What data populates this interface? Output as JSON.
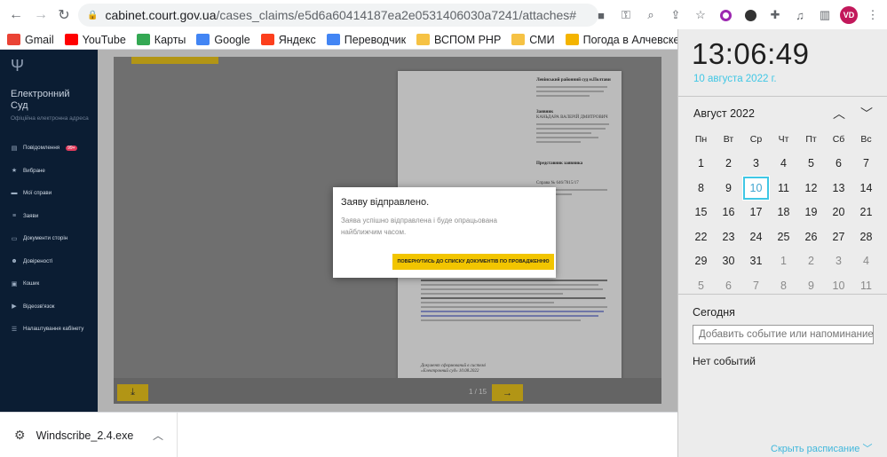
{
  "browser": {
    "url_host": "cabinet.court.gov.ua",
    "url_path": "/cases_claims/e5d6a60414187ea2e0531406030a7241/attaches#",
    "avatar": "VD",
    "bookmarks": [
      {
        "label": "Gmail",
        "icon": "gmail-icon",
        "color": "#ea4335"
      },
      {
        "label": "YouTube",
        "icon": "youtube-icon",
        "color": "#ff0000"
      },
      {
        "label": "Карты",
        "icon": "maps-icon",
        "color": "#34a853"
      },
      {
        "label": "Google",
        "icon": "google-icon",
        "color": "#4285f4"
      },
      {
        "label": "Яндекс",
        "icon": "yandex-icon",
        "color": "#fc3f1d"
      },
      {
        "label": "Переводчик",
        "icon": "translate-icon",
        "color": "#4285f4"
      },
      {
        "label": "ВСПОМ РНР",
        "icon": "folder-icon",
        "color": "#f6c244"
      },
      {
        "label": "СМИ",
        "icon": "folder-icon",
        "color": "#f6c244"
      },
      {
        "label": "Погода в Алчевске",
        "icon": "sun-icon",
        "color": "#f4b400"
      }
    ]
  },
  "site": {
    "title": "Електронний Суд",
    "subtitle": "Офіційна електронна адреса",
    "menu": [
      {
        "label": "Повідомлення",
        "badge": "99+",
        "icon": "chat-icon"
      },
      {
        "label": "Вибране",
        "badge": "",
        "icon": "star-icon"
      },
      {
        "label": "Мої справи",
        "badge": "",
        "icon": "folder-icon"
      },
      {
        "label": "Заяви",
        "badge": "",
        "icon": "list-icon"
      },
      {
        "label": "Документи сторін",
        "badge": "",
        "icon": "document-icon"
      },
      {
        "label": "Довіреності",
        "badge": "",
        "icon": "people-icon"
      },
      {
        "label": "Кошик",
        "badge": "",
        "icon": "cart-icon"
      },
      {
        "label": "Відеозв'язок",
        "badge": "",
        "icon": "video-icon"
      },
      {
        "label": "Налаштування кабінету",
        "badge": "",
        "icon": "settings-icon"
      }
    ]
  },
  "viewer": {
    "page_indicator": "1 / 15",
    "doc": {
      "court": "Ленінський районний суд м.Полтави",
      "applicant_label": "Заявник",
      "applicant_name": "КАНЬДАРА ВАЛЕРІЙ ДМИТРОВИЧ",
      "rep_label": "Представник заявника",
      "case_no": "Справа № 646/7815/17",
      "footer": "Документ сформований в системі «Електронний суд» 10.08.2022"
    }
  },
  "modal": {
    "title": "Заяву відправлено.",
    "body": "Заява успішно відправлена і буде опрацьована найближчим часом.",
    "button": "ПОВЕРНУТИСЬ ДО СПИСКУ ДОКУМЕНТІВ ПО ПРОВАДЖЕННЮ"
  },
  "download": {
    "filename": "Windscribe_2.4.exe"
  },
  "calendar": {
    "time": "13:06:49",
    "date": "10 августа 2022 г.",
    "month": "Август 2022",
    "weekdays": [
      "Пн",
      "Вт",
      "Ср",
      "Чт",
      "Пт",
      "Сб",
      "Вс"
    ],
    "days": [
      {
        "d": "1",
        "m": false
      },
      {
        "d": "2",
        "m": false
      },
      {
        "d": "3",
        "m": false
      },
      {
        "d": "4",
        "m": false
      },
      {
        "d": "5",
        "m": false
      },
      {
        "d": "6",
        "m": false
      },
      {
        "d": "7",
        "m": false
      },
      {
        "d": "8",
        "m": false
      },
      {
        "d": "9",
        "m": false
      },
      {
        "d": "10",
        "m": false,
        "today": true
      },
      {
        "d": "11",
        "m": false
      },
      {
        "d": "12",
        "m": false
      },
      {
        "d": "13",
        "m": false
      },
      {
        "d": "14",
        "m": false
      },
      {
        "d": "15",
        "m": false
      },
      {
        "d": "16",
        "m": false
      },
      {
        "d": "17",
        "m": false
      },
      {
        "d": "18",
        "m": false
      },
      {
        "d": "19",
        "m": false
      },
      {
        "d": "20",
        "m": false
      },
      {
        "d": "21",
        "m": false
      },
      {
        "d": "22",
        "m": false
      },
      {
        "d": "23",
        "m": false
      },
      {
        "d": "24",
        "m": false
      },
      {
        "d": "25",
        "m": false
      },
      {
        "d": "26",
        "m": false
      },
      {
        "d": "27",
        "m": false
      },
      {
        "d": "28",
        "m": false
      },
      {
        "d": "29",
        "m": false
      },
      {
        "d": "30",
        "m": false
      },
      {
        "d": "31",
        "m": false
      },
      {
        "d": "1",
        "m": true
      },
      {
        "d": "2",
        "m": true
      },
      {
        "d": "3",
        "m": true
      },
      {
        "d": "4",
        "m": true
      },
      {
        "d": "5",
        "m": true
      },
      {
        "d": "6",
        "m": true
      },
      {
        "d": "7",
        "m": true
      },
      {
        "d": "8",
        "m": true
      },
      {
        "d": "9",
        "m": true
      },
      {
        "d": "10",
        "m": true
      },
      {
        "d": "11",
        "m": true
      }
    ],
    "today_label": "Сегодня",
    "event_placeholder": "Добавить событие или напоминание",
    "no_events": "Нет событий",
    "hide_schedule": "Скрыть расписание"
  }
}
